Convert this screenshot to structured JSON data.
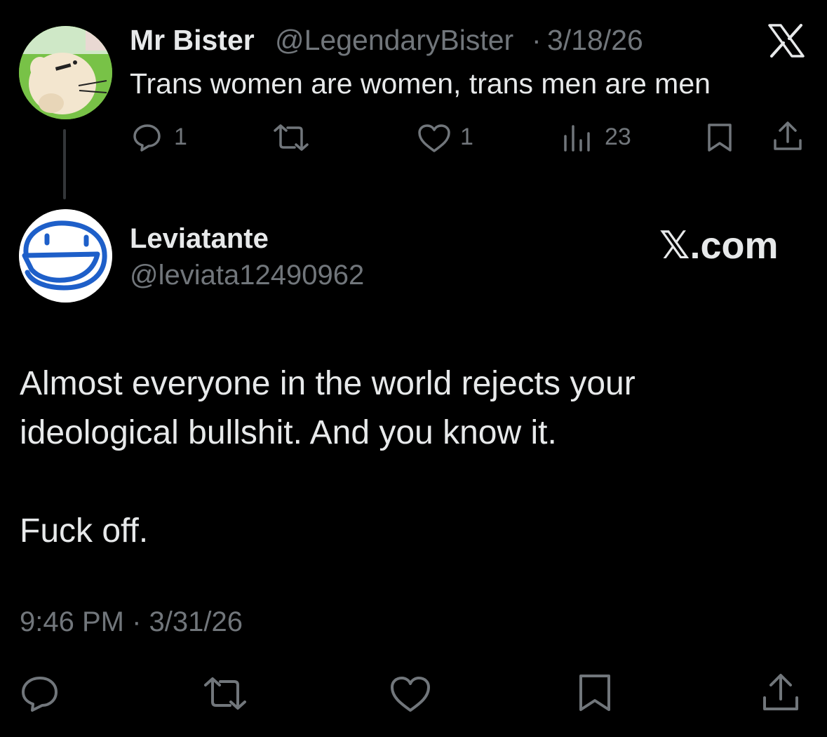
{
  "parent_tweet": {
    "display_name": "Mr Bister",
    "handle": "@LegendaryBister",
    "separator": "·",
    "date": "3/18/26",
    "text": "Trans women are women, trans men are men",
    "replies": "1",
    "likes": "1",
    "views": "23"
  },
  "reply_tweet": {
    "display_name": "Leviatante",
    "handle": "@leviata12490962",
    "watermark": "𝕏.com",
    "text_line1": "Almost everyone in the world rejects your ideological bullshit. And you know it.",
    "text_line2": "Fuck off.",
    "timestamp": "9:46 PM · 3/31/26"
  },
  "icons": {
    "x_logo": "x-logo-icon",
    "reply": "reply-icon",
    "retweet": "retweet-icon",
    "like": "heart-icon",
    "views": "views-icon",
    "bookmark": "bookmark-icon",
    "share": "share-icon"
  },
  "colors": {
    "background": "#000000",
    "primary_text": "#e7e9ea",
    "secondary_text": "#71767b",
    "avatar_reply_blue": "#1e5fc9"
  }
}
